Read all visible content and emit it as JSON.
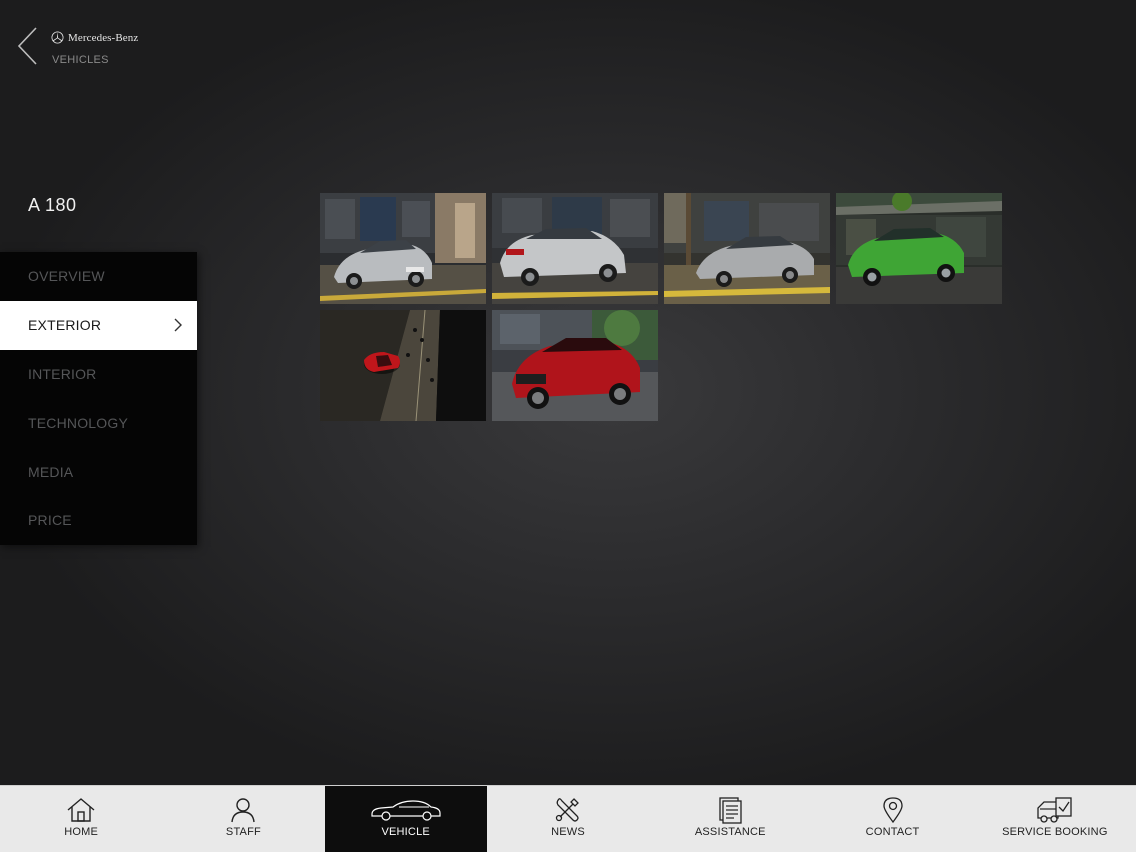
{
  "header": {
    "brand": "Mercedes-Benz",
    "breadcrumb": "VEHICLES"
  },
  "model": {
    "title": "A 180"
  },
  "side_menu": {
    "items": [
      {
        "label": "OVERVIEW",
        "active": false
      },
      {
        "label": "EXTERIOR",
        "active": true
      },
      {
        "label": "INTERIOR",
        "active": false
      },
      {
        "label": "TECHNOLOGY",
        "active": false
      },
      {
        "label": "MEDIA",
        "active": false
      },
      {
        "label": "PRICE",
        "active": false
      }
    ]
  },
  "gallery": {
    "photos": [
      {
        "subject": "silver A-Class front three-quarter view on city street",
        "car_color": "#b9bcbf"
      },
      {
        "subject": "silver A-Class rear three-quarter view",
        "car_color": "#c4c6c8"
      },
      {
        "subject": "silver A-Class front view by tree-lined street",
        "car_color": "#a9abad"
      },
      {
        "subject": "green A-Class front three-quarter view",
        "car_color": "#3fa535"
      },
      {
        "subject": "red A-Class aerial view on street with pedestrians",
        "car_color": "#c0161b"
      },
      {
        "subject": "red A-Class front three-quarter view",
        "car_color": "#b0141b"
      }
    ]
  },
  "tabbar": {
    "tabs": [
      {
        "label": "HOME",
        "icon": "home-icon",
        "active": false
      },
      {
        "label": "STAFF",
        "icon": "person-icon",
        "active": false
      },
      {
        "label": "VEHICLE",
        "icon": "car-icon",
        "active": true
      },
      {
        "label": "NEWS",
        "icon": "tools-icon",
        "active": false
      },
      {
        "label": "ASSISTANCE",
        "icon": "document-icon",
        "active": false
      },
      {
        "label": "CONTACT",
        "icon": "location-pin-icon",
        "active": false
      },
      {
        "label": "SERVICE BOOKING",
        "icon": "service-truck-icon",
        "active": false
      }
    ]
  },
  "colors": {
    "background": "#2c2c2e",
    "menu_bg": "#050505",
    "menu_active_bg": "#ffffff",
    "tabbar_bg": "#e9e9e9",
    "tab_active_bg": "#0d0d0d"
  }
}
